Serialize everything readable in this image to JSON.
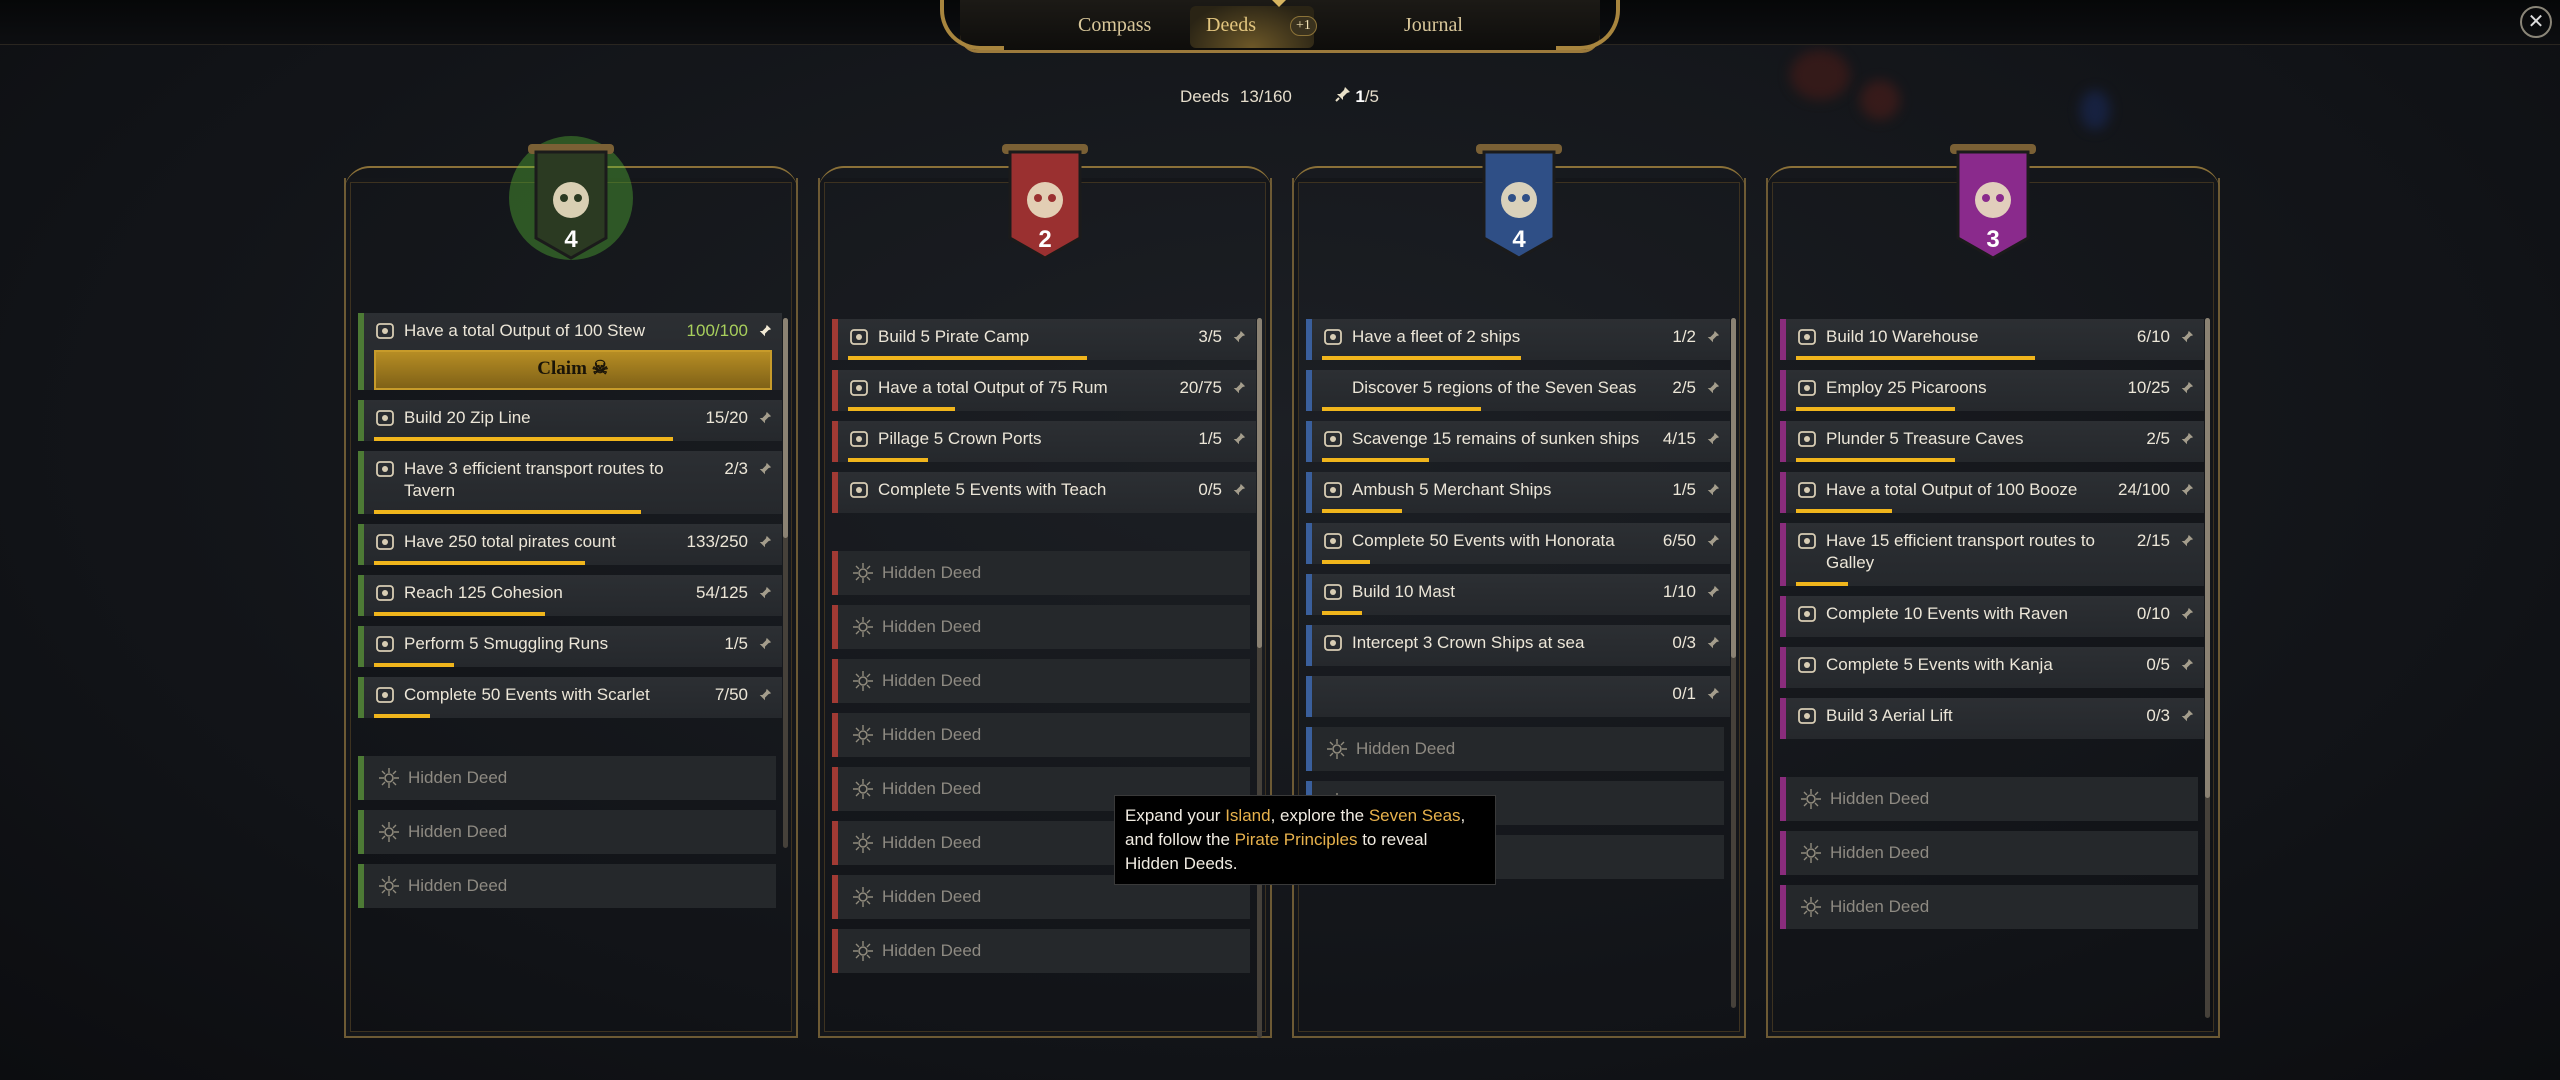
{
  "tabs": {
    "compass": "Compass",
    "deeds": "Deeds",
    "deeds_badge": "+1",
    "journal": "Journal"
  },
  "close_label": "✕",
  "summary": {
    "deeds_label": "Deeds",
    "deeds_count": "13/160",
    "pinned_current": "1",
    "pinned_total": "/5"
  },
  "colors": {
    "green": "#4d7a35",
    "red": "#a13a34",
    "blue": "#3a5f9c",
    "purple": "#8a2c7c",
    "gold_bar": "#f0b51c"
  },
  "claim_label": "Claim",
  "hidden_label": "Hidden Deed",
  "columns": [
    {
      "count": "4",
      "emblem": "skull-flag-icon",
      "accent": "#4d7a35",
      "deeds": [
        {
          "label": "Have a total Output of 100 Stew",
          "progress": "100/100",
          "fraction": 1.0,
          "icon": "stew-icon",
          "done": true,
          "claim": true
        },
        {
          "label": "Build 20 Zip Line",
          "progress": "15/20",
          "fraction": 0.75,
          "icon": "scroll-icon"
        },
        {
          "label": "Have 3 efficient transport routes to Tavern",
          "progress": "2/3",
          "fraction": 0.67,
          "icon": "route-icon"
        },
        {
          "label": "Have 250 total pirates count",
          "progress": "133/250",
          "fraction": 0.53,
          "icon": "pirates-icon"
        },
        {
          "label": "Reach 125 Cohesion",
          "progress": "54/125",
          "fraction": 0.43,
          "icon": "cohesion-icon"
        },
        {
          "label": "Perform 5 Smuggling Runs",
          "progress": "1/5",
          "fraction": 0.2,
          "icon": "smuggle-icon"
        },
        {
          "label": "Complete 50 Events with Scarlet",
          "progress": "7/50",
          "fraction": 0.14,
          "icon": "event-icon"
        }
      ],
      "hidden": 3
    },
    {
      "count": "2",
      "emblem": "crossed-swords-icon",
      "accent": "#a13a34",
      "deeds": [
        {
          "label": "Build 5 Pirate Camp",
          "progress": "3/5",
          "fraction": 0.6,
          "icon": "camp-icon"
        },
        {
          "label": "Have a total Output of 75 Rum",
          "progress": "20/75",
          "fraction": 0.27,
          "icon": "rum-icon"
        },
        {
          "label": "Pillage 5 Crown Ports",
          "progress": "1/5",
          "fraction": 0.2,
          "icon": "pillage-icon"
        },
        {
          "label": "Complete 5 Events with Teach",
          "progress": "0/5",
          "fraction": 0,
          "icon": "event-icon"
        }
      ],
      "hidden": 8
    },
    {
      "count": "4",
      "emblem": "anchor-icon",
      "accent": "#3a5f9c",
      "deeds": [
        {
          "label": "Have a fleet of 2 ships",
          "progress": "1/2",
          "fraction": 0.5,
          "icon": "fleet-icon"
        },
        {
          "label": "Discover 5 regions of the Seven Seas",
          "progress": "2/5",
          "fraction": 0.4,
          "icon": ""
        },
        {
          "label": "Scavenge 15 remains of sunken ships",
          "progress": "4/15",
          "fraction": 0.27,
          "icon": "scavenge-icon"
        },
        {
          "label": "Ambush 5 Merchant Ships",
          "progress": "1/5",
          "fraction": 0.2,
          "icon": "ambush-icon"
        },
        {
          "label": "Complete 50 Events with Honorata",
          "progress": "6/50",
          "fraction": 0.12,
          "icon": "event-icon"
        },
        {
          "label": "Build 10 Mast",
          "progress": "1/10",
          "fraction": 0.1,
          "icon": "scroll-icon"
        },
        {
          "label": "Intercept 3 Crown Ships at sea",
          "progress": "0/3",
          "fraction": 0,
          "icon": "intercept-icon"
        },
        {
          "label": "",
          "progress": "0/1",
          "fraction": 0,
          "icon": ""
        }
      ],
      "hidden": 3
    },
    {
      "count": "3",
      "emblem": "diamond-crown-icon",
      "accent": "#8a2c7c",
      "deeds": [
        {
          "label": "Build 10 Warehouse",
          "progress": "6/10",
          "fraction": 0.6,
          "icon": "warehouse-icon"
        },
        {
          "label": "Employ 25 Picaroons",
          "progress": "10/25",
          "fraction": 0.4,
          "icon": "picaroon-icon"
        },
        {
          "label": "Plunder 5 Treasure Caves",
          "progress": "2/5",
          "fraction": 0.4,
          "icon": "plunder-icon"
        },
        {
          "label": "Have a total Output of 100 Booze",
          "progress": "24/100",
          "fraction": 0.24,
          "icon": "booze-icon"
        },
        {
          "label": "Have 15 efficient transport routes to Galley",
          "progress": "2/15",
          "fraction": 0.13,
          "icon": "route-icon"
        },
        {
          "label": "Complete 10 Events with Raven",
          "progress": "0/10",
          "fraction": 0,
          "icon": "event-icon"
        },
        {
          "label": "Complete 5 Events with Kanja",
          "progress": "0/5",
          "fraction": 0,
          "icon": "event-icon"
        },
        {
          "label": "Build 3 Aerial Lift",
          "progress": "0/3",
          "fraction": 0,
          "icon": "scroll-icon"
        }
      ],
      "hidden": 3
    }
  ],
  "tooltip": {
    "t1": "Expand your ",
    "h1": "Island",
    "t2": ", explore the ",
    "h2": "Seven Seas",
    "t3": ", and follow the ",
    "h3": "Pirate Principles",
    "t4": " to reveal Hidden Deeds."
  }
}
